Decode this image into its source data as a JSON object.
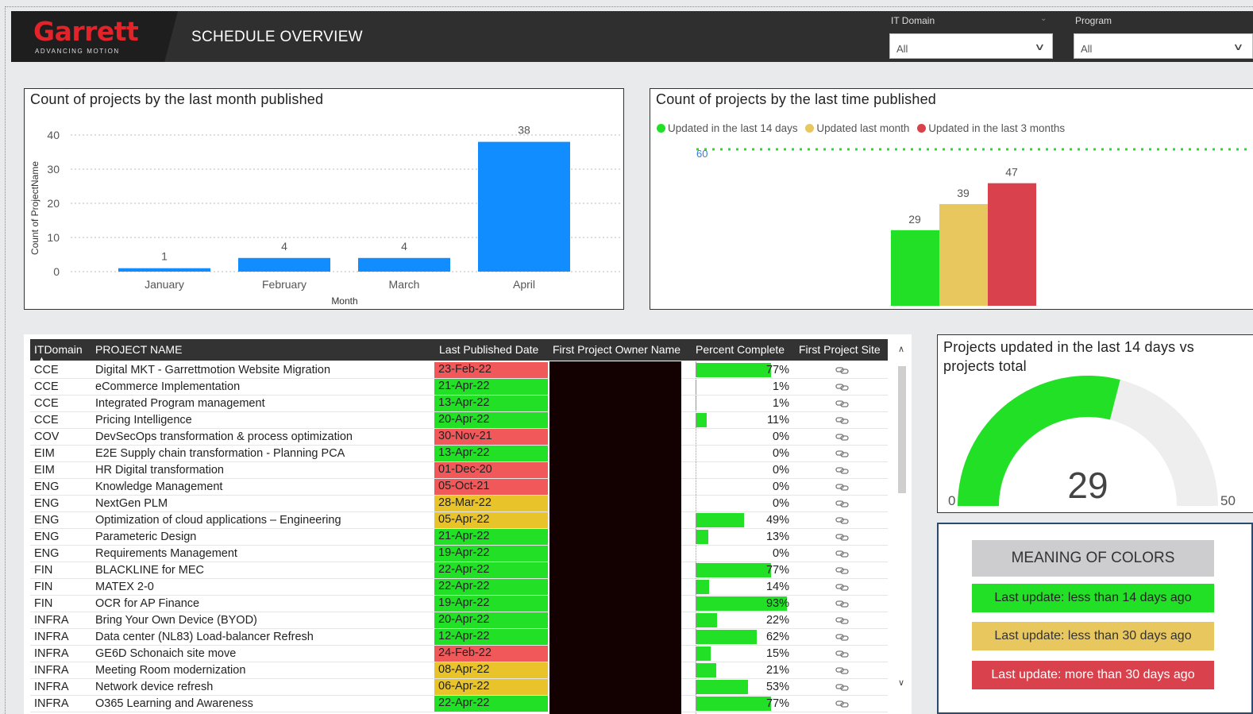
{
  "header": {
    "logo_text": "Garrett",
    "logo_sub": "ADVANCING MOTION",
    "page_title": "SCHEDULE OVERVIEW"
  },
  "filters": [
    {
      "label": "IT Domain",
      "value": "All"
    },
    {
      "label": "Program",
      "value": "All"
    }
  ],
  "chart_data": [
    {
      "type": "bar",
      "title": "Count of projects by the last month published",
      "xlabel": "Month",
      "ylabel": "Count of ProjectName",
      "categories": [
        "January",
        "February",
        "March",
        "April"
      ],
      "values": [
        1,
        4,
        4,
        38
      ],
      "data_labels": [
        "1",
        "4",
        "4",
        "38"
      ],
      "ylim": [
        0,
        40
      ],
      "yticks": [
        "0",
        "10",
        "20",
        "30",
        "40"
      ],
      "grid": true,
      "color": "#118dff"
    },
    {
      "type": "bar",
      "title": "Count of projects by the last time published",
      "series": [
        {
          "name": "Updated in the last 14 days",
          "values": [
            29
          ],
          "color": "#22e026"
        },
        {
          "name": "Updated last month",
          "values": [
            39
          ],
          "color": "#e8c75f"
        },
        {
          "name": "Updated in the last 3 months",
          "values": [
            47
          ],
          "color": "#d9414c"
        }
      ],
      "data_labels": [
        "29",
        "39",
        "47"
      ],
      "reference_line": {
        "value": 60,
        "label": "60"
      },
      "legend": "top-left"
    },
    {
      "type": "gauge",
      "title": "Projects updated in the last 14 days vs projects total",
      "value": 29,
      "min": 0,
      "max": 50,
      "value_label": "29",
      "min_label": "0",
      "max_label": "50",
      "fill_color": "#22e026"
    }
  ],
  "table": {
    "headers": [
      "ITDomain",
      "PROJECT NAME",
      "Last Published Date",
      "First Project Owner Name",
      "Percent Complete",
      "First Project Site"
    ],
    "rows": [
      {
        "domain": "CCE",
        "name": "Digital MKT - Garrettmotion Website Migration",
        "date": "23-Feb-22",
        "status": "red",
        "pct": "77%",
        "pct_val": 77
      },
      {
        "domain": "CCE",
        "name": "eCommerce Implementation",
        "date": "21-Apr-22",
        "status": "green",
        "pct": "1%",
        "pct_val": 1
      },
      {
        "domain": "CCE",
        "name": "Integrated Program management",
        "date": "13-Apr-22",
        "status": "green",
        "pct": "1%",
        "pct_val": 1
      },
      {
        "domain": "CCE",
        "name": "Pricing Intelligence",
        "date": "20-Apr-22",
        "status": "green",
        "pct": "11%",
        "pct_val": 11
      },
      {
        "domain": "COV",
        "name": "DevSecOps transformation & process optimization",
        "date": "30-Nov-21",
        "status": "red",
        "pct": "0%",
        "pct_val": 0
      },
      {
        "domain": "EIM",
        "name": "E2E Supply chain transformation - Planning PCA",
        "date": "13-Apr-22",
        "status": "green",
        "pct": "0%",
        "pct_val": 0
      },
      {
        "domain": "EIM",
        "name": "HR Digital transformation",
        "date": "01-Dec-20",
        "status": "red",
        "pct": "0%",
        "pct_val": 0
      },
      {
        "domain": "ENG",
        "name": "Knowledge Management",
        "date": "05-Oct-21",
        "status": "red",
        "pct": "0%",
        "pct_val": 0
      },
      {
        "domain": "ENG",
        "name": "NextGen PLM",
        "date": "28-Mar-22",
        "status": "yellow",
        "pct": "0%",
        "pct_val": 0
      },
      {
        "domain": "ENG",
        "name": "Optimization of cloud applications – Engineering",
        "date": "05-Apr-22",
        "status": "yellow",
        "pct": "49%",
        "pct_val": 49
      },
      {
        "domain": "ENG",
        "name": "Parameteric Design",
        "date": "21-Apr-22",
        "status": "green",
        "pct": "13%",
        "pct_val": 13
      },
      {
        "domain": "ENG",
        "name": "Requirements Management",
        "date": "19-Apr-22",
        "status": "green",
        "pct": "0%",
        "pct_val": 0
      },
      {
        "domain": "FIN",
        "name": "BLACKLINE for MEC",
        "date": "22-Apr-22",
        "status": "green",
        "pct": "77%",
        "pct_val": 77
      },
      {
        "domain": "FIN",
        "name": "MATEX 2-0",
        "date": "22-Apr-22",
        "status": "green",
        "pct": "14%",
        "pct_val": 14
      },
      {
        "domain": "FIN",
        "name": "OCR for AP Finance",
        "date": "19-Apr-22",
        "status": "green",
        "pct": "93%",
        "pct_val": 93
      },
      {
        "domain": "INFRA",
        "name": "Bring Your Own Device (BYOD)",
        "date": "20-Apr-22",
        "status": "green",
        "pct": "22%",
        "pct_val": 22
      },
      {
        "domain": "INFRA",
        "name": "Data center (NL83) Load-balancer Refresh",
        "date": "12-Apr-22",
        "status": "green",
        "pct": "62%",
        "pct_val": 62
      },
      {
        "domain": "INFRA",
        "name": "GE6D Schonaich site move",
        "date": "24-Feb-22",
        "status": "red",
        "pct": "15%",
        "pct_val": 15
      },
      {
        "domain": "INFRA",
        "name": "Meeting Room modernization",
        "date": "08-Apr-22",
        "status": "yellow",
        "pct": "21%",
        "pct_val": 21
      },
      {
        "domain": "INFRA",
        "name": "Network device refresh",
        "date": "06-Apr-22",
        "status": "yellow",
        "pct": "53%",
        "pct_val": 53
      },
      {
        "domain": "INFRA",
        "name": "O365 Learning and Awareness",
        "date": "22-Apr-22",
        "status": "green",
        "pct": "77%",
        "pct_val": 77
      }
    ]
  },
  "status_colors": {
    "green": "#22e026",
    "yellow": "#e8c32a",
    "red": "#f0585a"
  },
  "legend_box": {
    "title": "MEANING OF COLORS",
    "items": [
      {
        "label": "Last update: less than 14 days ago",
        "color": "#22e026"
      },
      {
        "label": "Last update: less than 30 days ago",
        "color": "#e8c75f"
      },
      {
        "label": "Last update: more than 30 days ago",
        "color": "#d9414c"
      }
    ]
  },
  "icons": [
    "link-icon",
    "chevron-down-icon",
    "scroll-up-icon",
    "scroll-down-icon"
  ]
}
